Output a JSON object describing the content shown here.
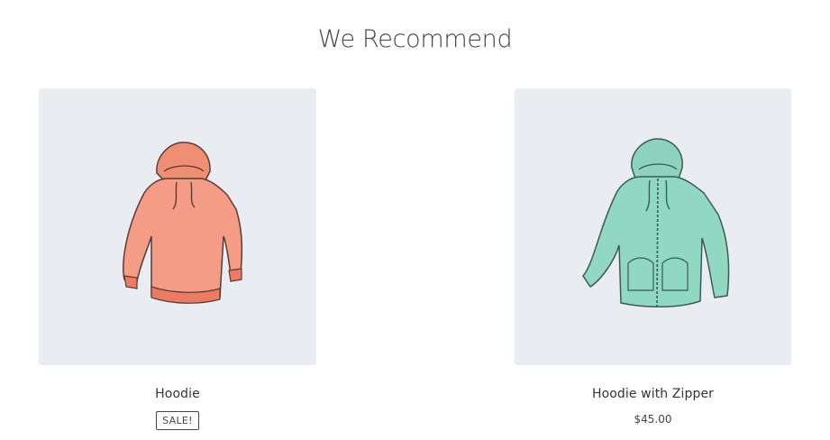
{
  "section": {
    "title": "We Recommend"
  },
  "products": [
    {
      "name": "Hoodie",
      "badge": "SALE!",
      "color": "#f39477",
      "icon": "hoodie-image"
    },
    {
      "name": "Hoodie with Zipper",
      "price": "$45.00",
      "color": "#8fd3bf",
      "icon": "hoodie-with-zipper-image"
    }
  ],
  "colors": {
    "card_background": "#e9edf2",
    "text": "#43454b"
  }
}
